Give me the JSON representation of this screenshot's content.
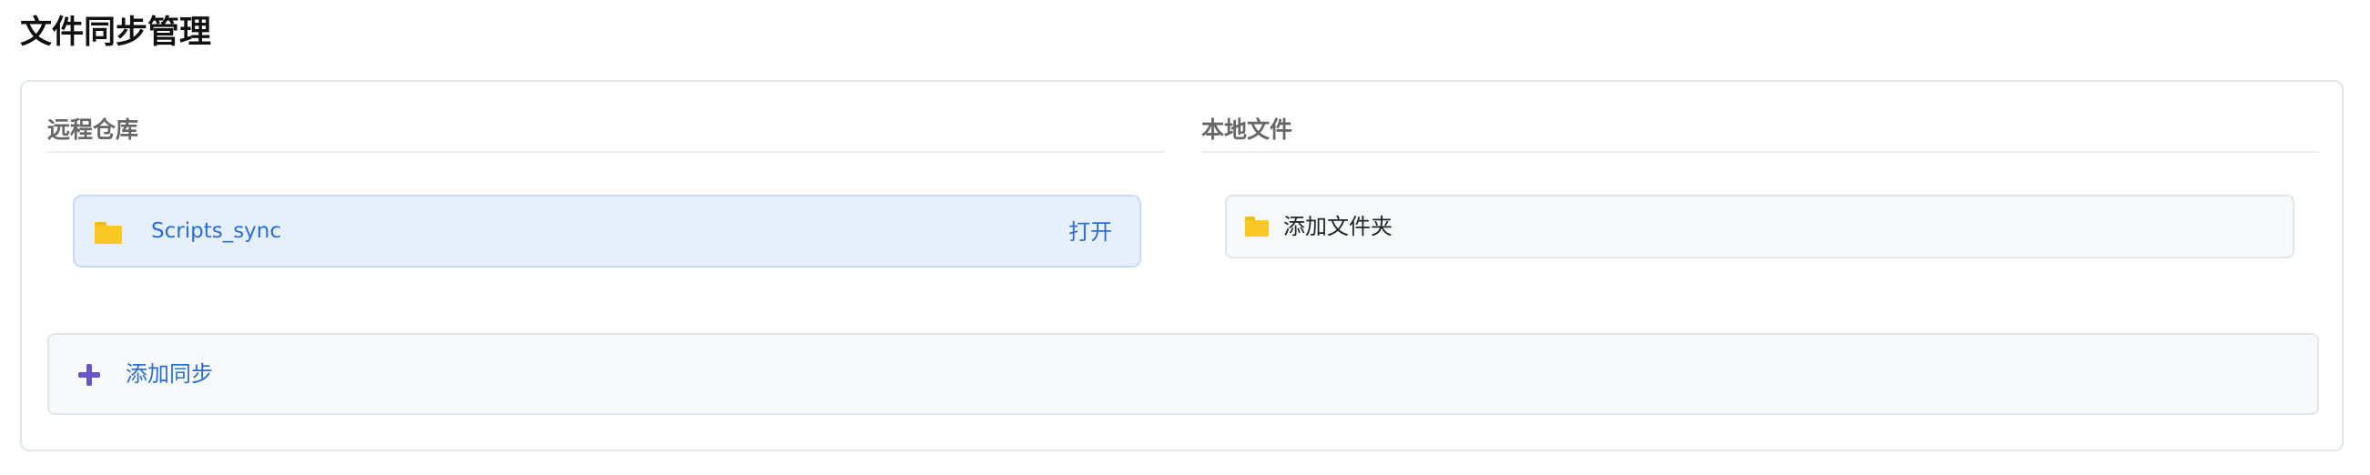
{
  "page": {
    "title": "文件同步管理"
  },
  "remote": {
    "heading": "远程仓库",
    "items": [
      {
        "name": "Scripts_sync",
        "action_label": "打开",
        "icon": "folder-icon"
      }
    ]
  },
  "local": {
    "heading": "本地文件",
    "add_folder_label": "添加文件夹",
    "icon": "folder-icon"
  },
  "add_sync": {
    "label": "添加同步",
    "icon": "plus-icon"
  },
  "colors": {
    "accent": "#2a6fd6",
    "plus": "#6b56c8",
    "folder": "#f9c825",
    "selected_bg": "#e8effc"
  }
}
